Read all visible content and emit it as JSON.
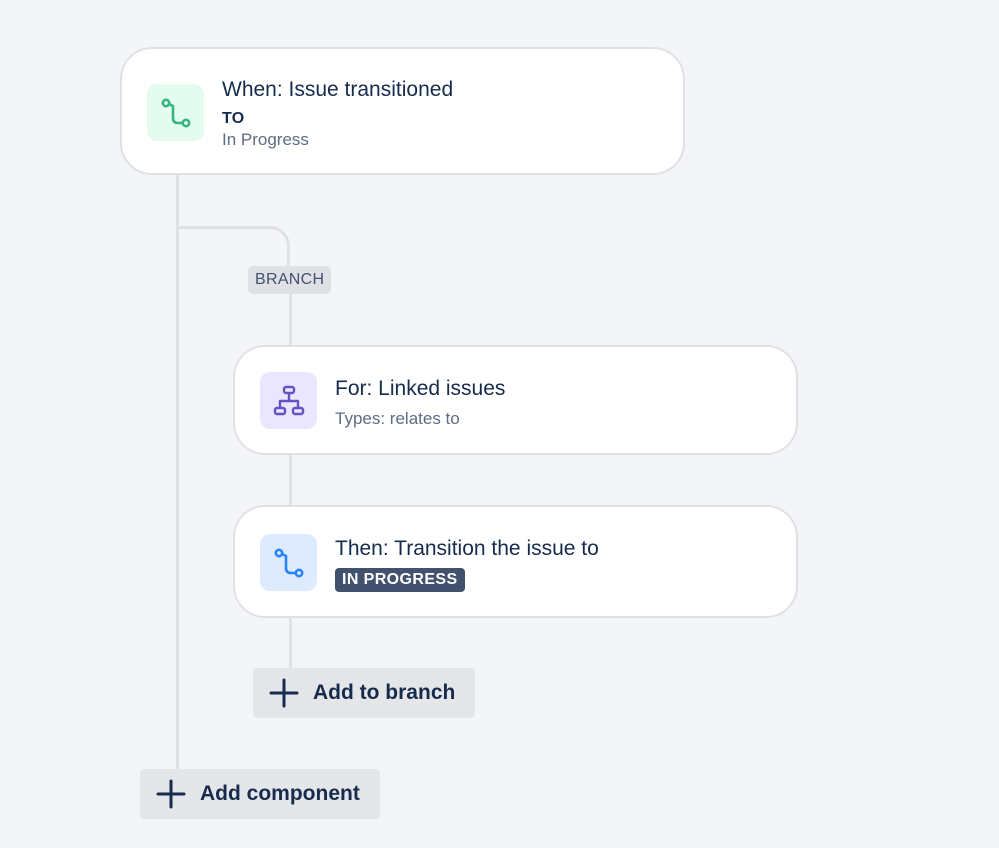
{
  "trigger": {
    "title": "When: Issue transitioned",
    "detail_label": "TO",
    "detail_value": "In Progress",
    "icon": "transition-icon",
    "icon_color": "#36b37e",
    "icon_bg": "#e3fcef"
  },
  "branch": {
    "tag": "BRANCH",
    "condition": {
      "title": "For: Linked issues",
      "subtitle": "Types: relates to",
      "icon": "hierarchy-icon",
      "icon_color": "#6554c0",
      "icon_bg": "#eae6ff"
    },
    "action": {
      "title": "Then: Transition the issue to",
      "status": "IN PROGRESS",
      "icon": "transition-icon",
      "icon_color": "#2684ff",
      "icon_bg": "#deebff"
    },
    "add_label": "Add to branch"
  },
  "add_component_label": "Add component"
}
